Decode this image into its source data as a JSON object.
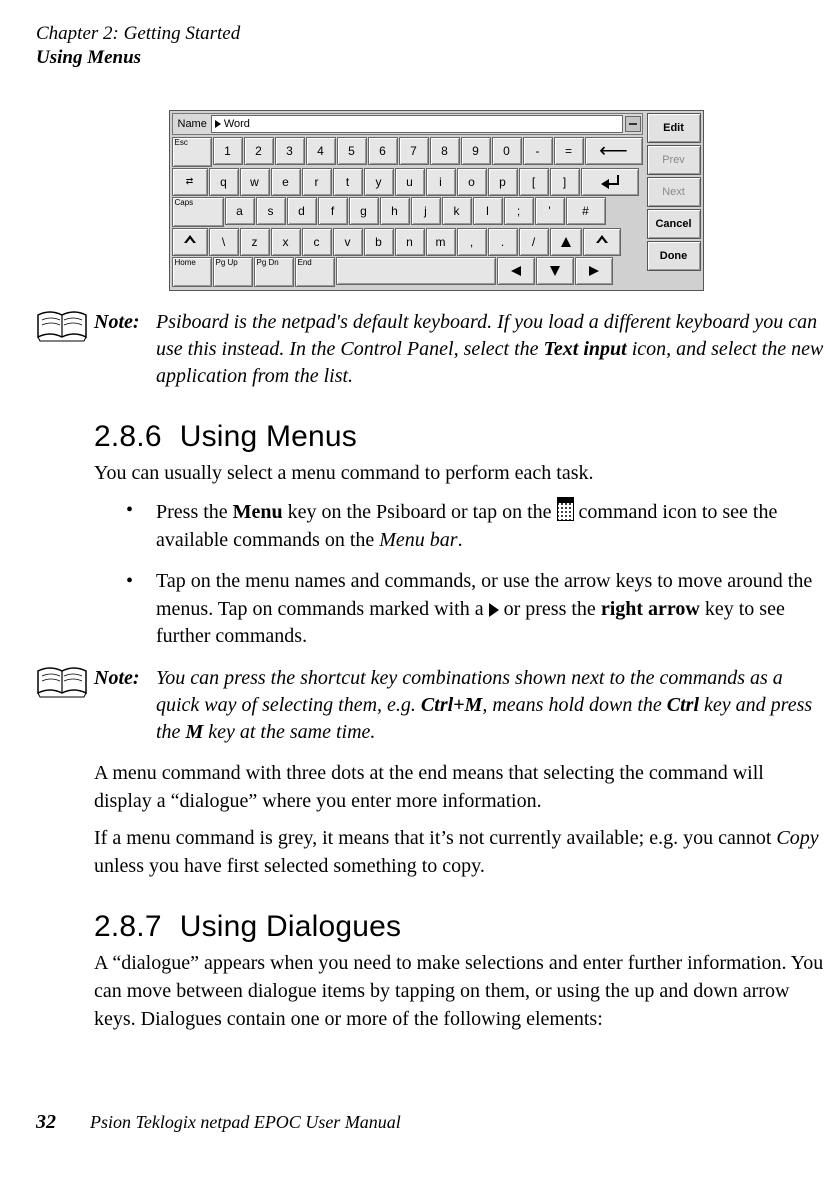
{
  "header": {
    "chapter": "Chapter 2:  Getting Started",
    "section": "Using Menus"
  },
  "keyboard": {
    "name_label": "Name",
    "name_value": "Word",
    "side_buttons": {
      "edit": "Edit",
      "prev": "Prev",
      "next": "Next",
      "cancel": "Cancel",
      "done": "Done"
    },
    "row1_left": "Esc",
    "row1": [
      "1",
      "2",
      "3",
      "4",
      "5",
      "6",
      "7",
      "8",
      "9",
      "0",
      "-",
      "="
    ],
    "row2": [
      "q",
      "w",
      "e",
      "r",
      "t",
      "y",
      "u",
      "i",
      "o",
      "p",
      "[",
      "]"
    ],
    "row3_left": "Caps",
    "row3": [
      "a",
      "s",
      "d",
      "f",
      "g",
      "h",
      "j",
      "k",
      "l",
      ";",
      "'",
      "#"
    ],
    "row4": [
      "\\",
      "z",
      "x",
      "c",
      "v",
      "b",
      "n",
      "m",
      ",",
      ".",
      "/"
    ],
    "row5_left": [
      "Home",
      "Pg Up",
      "Pg Dn",
      "End"
    ]
  },
  "notes": {
    "label": "Note:",
    "note1_a": "Psiboard is the netpad's default keyboard. If you load a different keyboard you can use this instead. In the Control Panel, select the ",
    "note1_b": "Text input",
    "note1_c": " icon, and select the new application from the list.",
    "note2_a": "You can press the shortcut key combinations shown next to the commands as a quick way of selecting them, e.g. ",
    "note2_b": "Ctrl+M",
    "note2_c": ", means hold down the ",
    "note2_d": "Ctrl",
    "note2_e": " key and press the ",
    "note2_f": "M",
    "note2_g": " key at the same time."
  },
  "sections": {
    "s286_num": "2.8.6",
    "s286_title": "Using Menus",
    "s286_p1": "You can usually select a menu command to perform each task.",
    "s286_b1_a": "Press the ",
    "s286_b1_b": "Menu",
    "s286_b1_c": " key on the Psiboard or tap on the ",
    "s286_b1_d": " command icon to see the available commands on the ",
    "s286_b1_e": "Menu bar",
    "s286_b1_f": ".",
    "s286_b2_a": "Tap on the menu names and commands, or use the arrow keys to move around the menus. Tap on commands marked with a ",
    "s286_b2_b": " or press the ",
    "s286_b2_c": "right arrow",
    "s286_b2_d": " key to see further commands.",
    "s286_p2": "A menu command with three dots at the end means that selecting the command will display a “dialogue” where you enter more information.",
    "s286_p3_a": "If a menu command is grey, it means that it’s not currently available; e.g. you cannot ",
    "s286_p3_b": "Copy",
    "s286_p3_c": " unless you have first selected something to copy.",
    "s287_num": "2.8.7",
    "s287_title": "Using Dialogues",
    "s287_p1": "A “dialogue” appears when you need to make selections and enter further information. You can move between dialogue items by tapping on them, or using the up and down arrow keys. Dialogues contain one or more of the following elements:"
  },
  "footer": {
    "page": "32",
    "book": "Psion Teklogix netpad EPOC User Manual"
  }
}
